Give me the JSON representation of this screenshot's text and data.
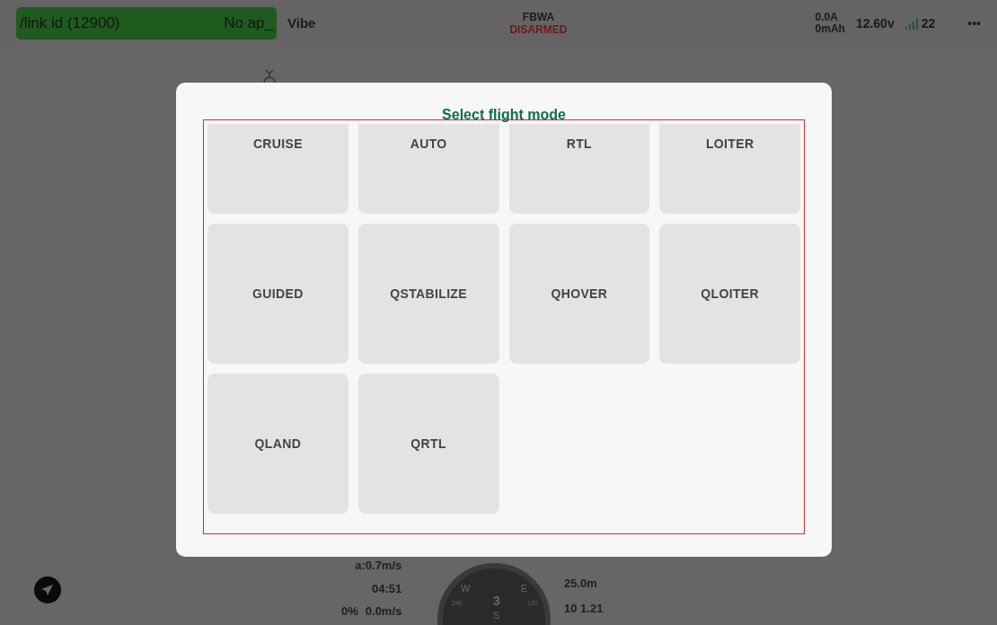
{
  "status_bar": {
    "link": "/link id (12900)",
    "link_status": "No ap_",
    "vehicle": "Vibe",
    "mode": "FBWA",
    "arm_state": "DISARMED",
    "current": "0.0A",
    "consumed": "0mAh",
    "voltage": "12.60v",
    "satellites": "22",
    "menu": "•••"
  },
  "hud": {
    "accel": "a:0.7m/s",
    "time": "04:51",
    "throttle": "0%",
    "vspeed": "0.0m/s",
    "altitude": "25.0m",
    "gps": "10 1.21",
    "compass_heading": "3",
    "compass_w": "W",
    "compass_e": "E",
    "compass_s": "S",
    "compass_240": "240",
    "compass_120": "120"
  },
  "dialog": {
    "title": "Select flight mode",
    "modes": [
      {
        "label": "CRUISE"
      },
      {
        "label": "AUTO"
      },
      {
        "label": "RTL"
      },
      {
        "label": "LOITER"
      },
      {
        "label": "GUIDED"
      },
      {
        "label": "QSTABILIZE"
      },
      {
        "label": "QHOVER"
      },
      {
        "label": "QLOITER"
      },
      {
        "label": "QLAND"
      },
      {
        "label": "QRTL"
      }
    ]
  }
}
